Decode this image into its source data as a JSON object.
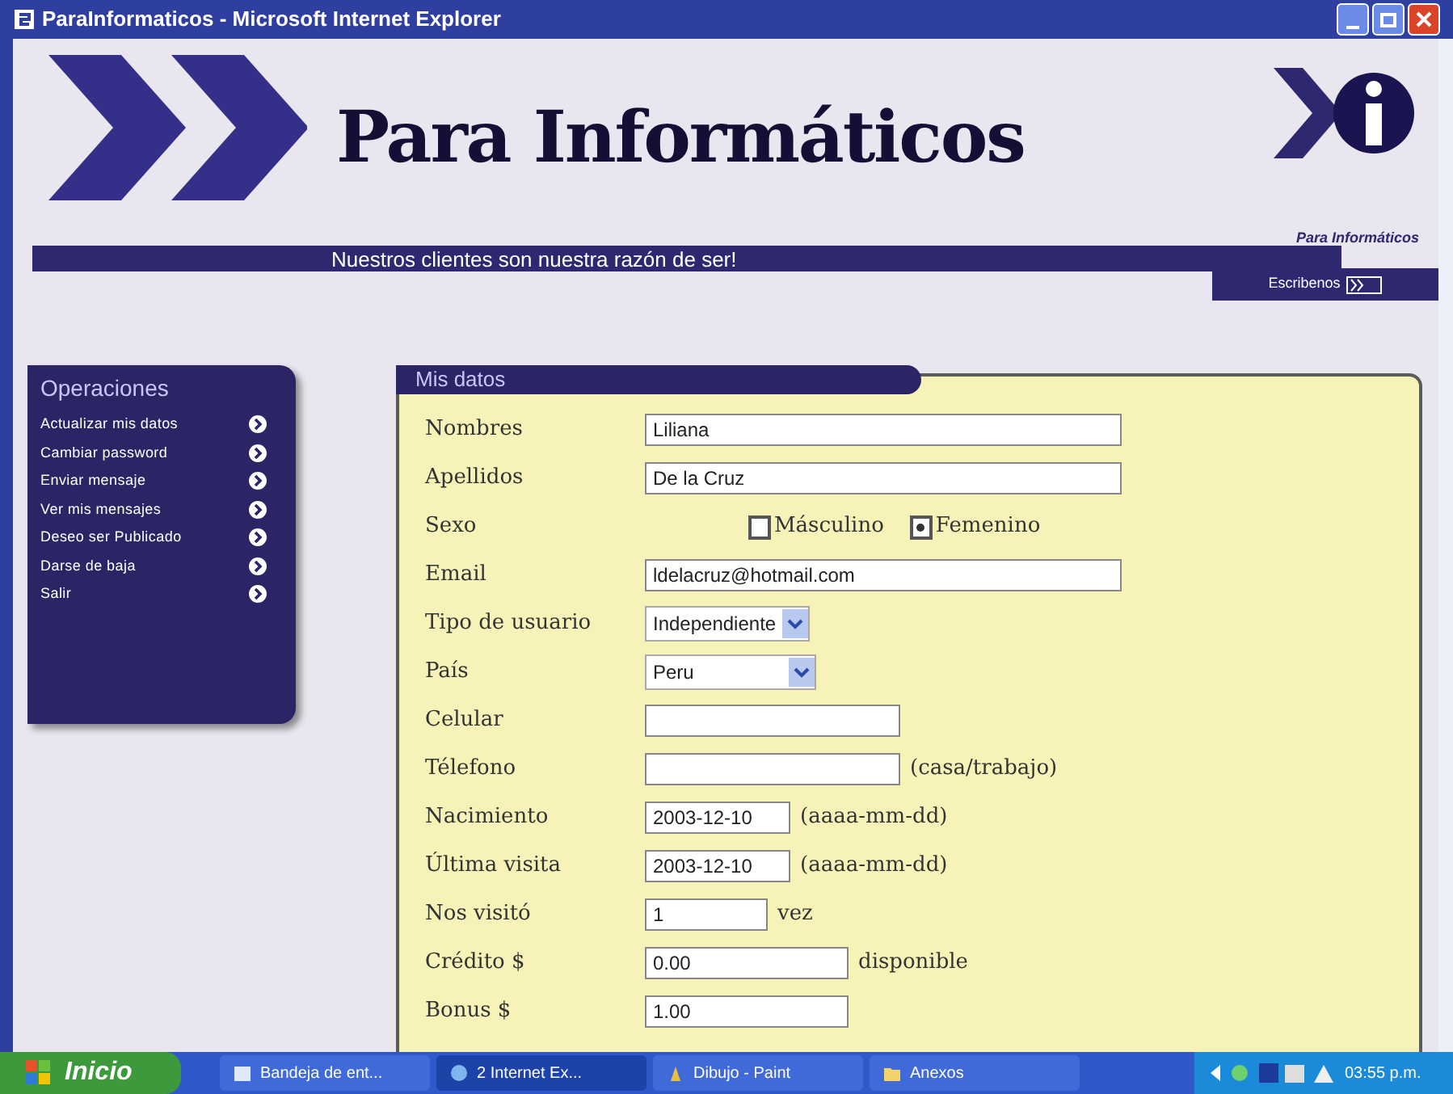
{
  "window": {
    "title": "ParaInformaticos - Microsoft Internet Explorer"
  },
  "header": {
    "title": "Para Informáticos",
    "slogan": "Nuestros clientes son nuestra razón de ser!",
    "logo_caption": "Para Informáticos",
    "contact_button": "Escribenos"
  },
  "sidebar": {
    "title": "Operaciones",
    "items": [
      {
        "label": "Actualizar mis datos"
      },
      {
        "label": "Cambiar password"
      },
      {
        "label": "Enviar mensaje"
      },
      {
        "label": "Ver mis mensajes"
      },
      {
        "label": "Deseo ser Publicado"
      },
      {
        "label": "Darse de baja"
      },
      {
        "label": "Salir"
      }
    ]
  },
  "form": {
    "title": "Mis datos",
    "rows": [
      {
        "kind": "text",
        "label": "Nombres",
        "value": "Liliana"
      },
      {
        "kind": "text",
        "label": "Apellidos",
        "value": "De la Cruz"
      },
      {
        "kind": "radio",
        "label": "Sexo",
        "options": [
          {
            "label": "Másculino",
            "selected": false
          },
          {
            "label": "Femenino",
            "selected": true
          }
        ]
      },
      {
        "kind": "text",
        "label": "Email",
        "value": "ldelacruz@hotmail.com"
      },
      {
        "kind": "select",
        "label": "Tipo de usuario",
        "value": "Independiente"
      },
      {
        "kind": "select",
        "label": "País",
        "value": "Peru"
      },
      {
        "kind": "text",
        "label": "Celular",
        "value": ""
      },
      {
        "kind": "text",
        "label": "Télefono",
        "value": "",
        "suffix": "(casa/trabajo)"
      },
      {
        "kind": "text",
        "label": "Nacimiento",
        "value": "2003-12-10",
        "suffix": "(aaaa-mm-dd)"
      },
      {
        "kind": "text",
        "label": "Última visita",
        "value": "2003-12-10",
        "suffix": "(aaaa-mm-dd)"
      },
      {
        "kind": "text",
        "label": "Nos visitó",
        "value": "1",
        "suffix": "vez"
      },
      {
        "kind": "text",
        "label": "Crédito $",
        "value": "0.00",
        "suffix": "disponible"
      },
      {
        "kind": "text",
        "label": "Bonus $",
        "value": "1.00"
      }
    ]
  },
  "taskbar": {
    "start": "Inicio",
    "tasks": [
      {
        "label": "Bandeja de ent...",
        "selected": false
      },
      {
        "label": "2 Internet Ex...",
        "selected": true
      },
      {
        "label": "Dibujo - Paint",
        "selected": false
      },
      {
        "label": "Anexos",
        "selected": false
      }
    ],
    "clock": "03:55 p.m."
  }
}
